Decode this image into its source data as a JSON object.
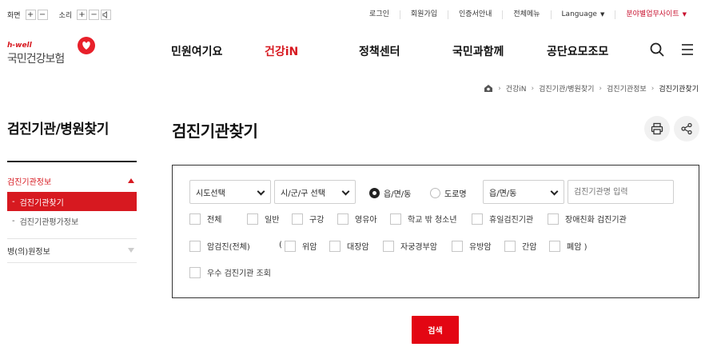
{
  "util": {
    "screen_label": "화면",
    "sound_label": "소리",
    "plus": "+",
    "minus": "−",
    "links": [
      "로그인",
      "회원가입",
      "인증서안내",
      "전체메뉴"
    ],
    "language": "Language",
    "bunya": "분야별업무사이트",
    "brand_red": "#d71920"
  },
  "header": {
    "logo_small": "h-well",
    "logo_name": "국민건강보험",
    "menu": [
      "민원여기요",
      "건강iN",
      "정책센터",
      "국민과함께",
      "공단요모조모"
    ],
    "active_menu": "건강iN"
  },
  "breadcrumb": [
    "건강iN",
    "검진기관/병원찾기",
    "검진기관정보",
    "검진기관찾기"
  ],
  "sidebar": {
    "title": "검진기관/병원찾기",
    "section1": "검진기관정보",
    "sub_items": [
      "검진기관찾기",
      "검진기관평가정보"
    ],
    "section2": "병(의)원정보"
  },
  "main": {
    "title": "검진기관찾기",
    "form": {
      "sido": "시도선택",
      "sigungu": "시/군/구 선택",
      "radio_options": [
        "읍/면/동",
        "도로명"
      ],
      "dong": "읍/면/동",
      "name_placeholder": "검진기관명 입력",
      "row1": [
        "전체",
        "일반",
        "구강",
        "영유아",
        "학교 밖 청소년",
        "휴일검진기관",
        "장애친화 검진기관"
      ],
      "cancer_all": "암검진(전체)",
      "paren_open": "(",
      "cancers": [
        "위암",
        "대장암",
        "자궁경부암",
        "유방암",
        "간암",
        "폐암 )"
      ],
      "excellent": "우수 검진기관 조회"
    },
    "search_button": "검색"
  }
}
